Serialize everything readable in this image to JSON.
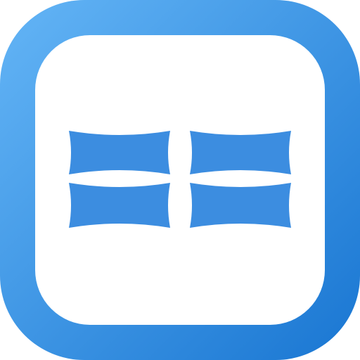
{
  "icon": {
    "name": "window-panes-icon",
    "colors": {
      "gradient_start": "#64B5F6",
      "gradient_end": "#1976D2",
      "inner_background": "#FFFFFF",
      "pane_fill": "#3C8DE0"
    },
    "panes": 4
  }
}
